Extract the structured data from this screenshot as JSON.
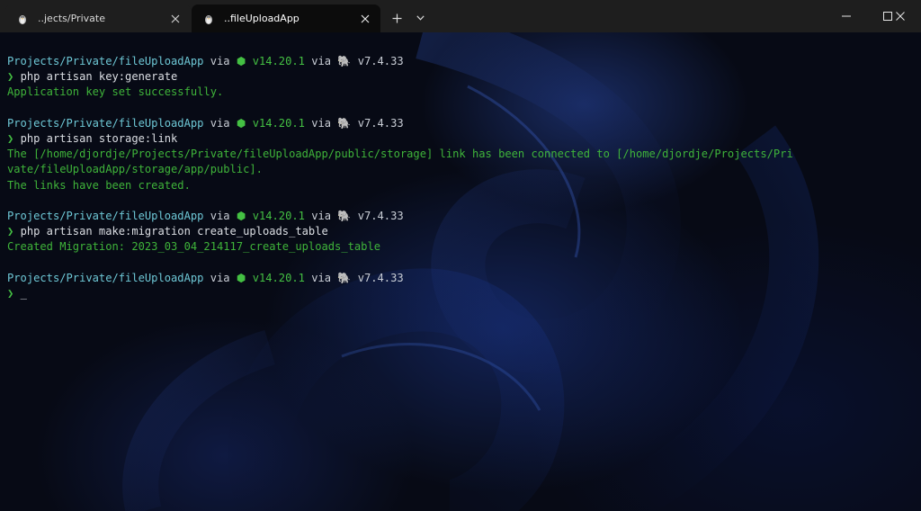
{
  "tabs": [
    {
      "label": "..jects/Private",
      "icon": "linux-tux-icon"
    },
    {
      "label": "..fileUploadApp",
      "icon": "linux-tux-icon",
      "active": true
    }
  ],
  "window_controls": [
    "minimize",
    "maximize",
    "close"
  ],
  "terminal": {
    "blocks": [
      {
        "prompt": {
          "path": "Projects/Private/fileUploadApp",
          "via1": "via",
          "node_icon": "⬢",
          "node_version": "v14.20.1",
          "via2": "via",
          "php_icon": "🐘",
          "php_version": "v7.4.33"
        },
        "prompt_char": "❯",
        "command": "php artisan key:generate",
        "output": [
          "Application key set successfully."
        ]
      },
      {
        "prompt": {
          "path": "Projects/Private/fileUploadApp",
          "via1": "via",
          "node_icon": "⬢",
          "node_version": "v14.20.1",
          "via2": "via",
          "php_icon": "🐘",
          "php_version": "v7.4.33"
        },
        "prompt_char": "❯",
        "command": "php artisan storage:link",
        "output": [
          "The [/home/djordje/Projects/Private/fileUploadApp/public/storage] link has been connected to [/home/djordje/Projects/Pri",
          "vate/fileUploadApp/storage/app/public].",
          "The links have been created."
        ]
      },
      {
        "prompt": {
          "path": "Projects/Private/fileUploadApp",
          "via1": "via",
          "node_icon": "⬢",
          "node_version": "v14.20.1",
          "via2": "via",
          "php_icon": "🐘",
          "php_version": "v7.4.33"
        },
        "prompt_char": "❯",
        "command": "php artisan make:migration create_uploads_table",
        "output": [
          "Created Migration: 2023_03_04_214117_create_uploads_table"
        ]
      },
      {
        "prompt": {
          "path": "Projects/Private/fileUploadApp",
          "via1": "via",
          "node_icon": "⬢",
          "node_version": "v14.20.1",
          "via2": "via",
          "php_icon": "🐘",
          "php_version": "v7.4.33"
        },
        "prompt_char": "❯",
        "command": "",
        "cursor": "_",
        "output": []
      }
    ]
  },
  "colors": {
    "path": "#6ec8d6",
    "green": "#44c043",
    "output": "#3fb43a",
    "text": "#c9ced6",
    "titlebar": "#1e1e1e",
    "active_tab": "#0c0c0c"
  }
}
